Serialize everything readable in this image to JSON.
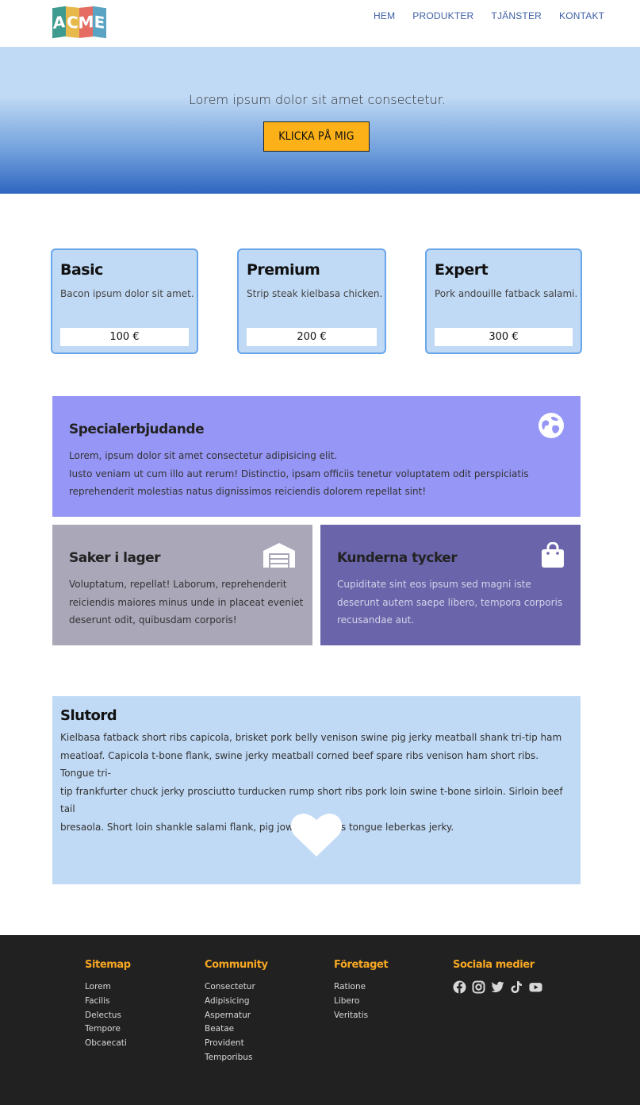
{
  "brand": {
    "logo_letters": [
      "A",
      "C",
      "M",
      "E"
    ]
  },
  "nav": {
    "items": [
      {
        "label": "HEM"
      },
      {
        "label": "PRODUKTER"
      },
      {
        "label": "TJÄNSTER"
      },
      {
        "label": "KONTAKT"
      }
    ]
  },
  "hero": {
    "text": "Lorem ipsum dolor sit amet consectetur.",
    "button_label": "KLICKA PÅ MIG"
  },
  "plans": [
    {
      "title": "Basic",
      "description": "Bacon ipsum dolor sit amet.",
      "price": "100 €"
    },
    {
      "title": "Premium",
      "description": "Strip steak kielbasa chicken.",
      "price": "200 €"
    },
    {
      "title": "Expert",
      "description": "Pork andouille fatback salami.",
      "price": "300 €"
    }
  ],
  "offer": {
    "title": "Specialerbjudande",
    "line1": "Lorem, ipsum dolor sit amet consectetur adipisicing elit.",
    "line2": "Iusto veniam ut cum illo aut rerum! Distinctio, ipsam officiis tenetur voluptatem odit perspiciatis",
    "line3": "reprehenderit molestias natus dignissimos reiciendis dolorem repellat sint!",
    "icon": "globe-icon"
  },
  "stock": {
    "title": "Saker i lager",
    "line1": "Voluptatum, repellat! Laborum, reprehenderit",
    "line2": "reiciendis maiores minus unde in placeat eveniet",
    "line3": "deserunt odit, quibusdam corporis!",
    "icon": "warehouse-icon"
  },
  "reviews": {
    "title": "Kunderna tycker",
    "line1": "Cupiditate sint eos ipsum sed magni iste",
    "line2": "deserunt autem saepe libero, tempora corporis",
    "line3": "recusandae aut.",
    "icon": "shopping-bag-icon"
  },
  "closing": {
    "title": "Slutord",
    "line1": "Kielbasa fatback short ribs capicola, brisket pork belly venison swine pig jerky meatball shank tri-tip ham",
    "line2": "meatloaf. Capicola t-bone flank, swine jerky meatball corned beef spare ribs venison ham short ribs. Tongue tri-",
    "line3": "tip frankfurter chuck jerky prosciutto turducken rump short ribs pork loin swine t-bone sirloin. Sirloin beef tail",
    "line4": "bresaola. Short loin shankle salami flank, pig jowl spare ribs tongue leberkas jerky.",
    "icon": "heart-icon"
  },
  "footer": {
    "sitemap": {
      "heading": "Sitemap",
      "links": [
        "Lorem",
        "Facilis",
        "Delectus",
        "Tempore",
        "Obcaecati"
      ]
    },
    "community": {
      "heading": "Community",
      "links": [
        "Consectetur",
        "Adipisicing",
        "Aspernatur",
        "Beatae",
        "Provident",
        "Temporibus"
      ]
    },
    "company": {
      "heading": "Företaget",
      "links": [
        "Ratione",
        "Libero",
        "Veritatis"
      ]
    },
    "social": {
      "heading": "Sociala medier",
      "icons": [
        "facebook-icon",
        "instagram-icon",
        "twitter-icon",
        "tiktok-icon",
        "youtube-icon"
      ]
    }
  },
  "colors": {
    "accent": "#fbb117",
    "light_blue": "#c0d9f4",
    "offer_bg": "#9696f6",
    "stock_bg": "#a9a7b8",
    "reviews_bg": "#6a65aa",
    "footer_bg": "#212121",
    "footer_heading": "#f5a623",
    "nav_text": "#3e5fa6"
  }
}
